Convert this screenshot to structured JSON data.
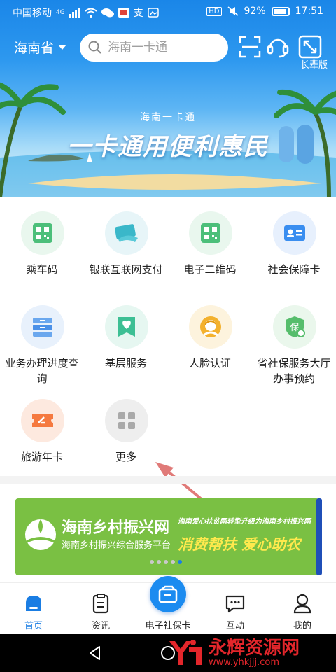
{
  "status_bar": {
    "carrier": "中国移动",
    "network": "4G",
    "hd": "HD",
    "battery": "92%",
    "time": "17:51"
  },
  "header": {
    "province": "海南省",
    "search_placeholder": "海南一卡通",
    "elder_mode_label": "长辈版",
    "icons": [
      "scan-icon",
      "customer-service-icon",
      "elder-mode-icon"
    ]
  },
  "hero_banner": {
    "subtitle": "海南一卡通",
    "title": "一卡通用便利惠民"
  },
  "services": [
    {
      "label": "乘车码",
      "icon": "qr-code-icon",
      "color": "#4cbf7a"
    },
    {
      "label": "银联互联网支付",
      "icon": "card-payment-icon",
      "color": "#3ab7c9"
    },
    {
      "label": "电子二维码",
      "icon": "qr-code-icon",
      "color": "#4cbf7a"
    },
    {
      "label": "社会保障卡",
      "icon": "id-card-icon",
      "color": "#3a8ef0"
    },
    {
      "label": "业务办理进度查询",
      "icon": "progress-query-icon",
      "color": "#4a90e8"
    },
    {
      "label": "基层服务",
      "icon": "heart-hand-icon",
      "color": "#3dbf94"
    },
    {
      "label": "人脸认证",
      "icon": "face-icon",
      "color": "#f3b12e"
    },
    {
      "label": "省社保服务大厅办事预约",
      "icon": "appointment-icon",
      "color": "#56bd6c"
    },
    {
      "label": "旅游年卡",
      "icon": "ticket-icon",
      "color": "#f5793f"
    },
    {
      "label": "更多",
      "icon": "more-grid-icon",
      "color": "#a9a9a9"
    }
  ],
  "promo": {
    "title": "海南乡村振兴网",
    "subtitle": "海南乡村振兴综合服务平台",
    "tagline_small": "海南爱心扶贫网转型升级为海南乡村振兴网",
    "tagline_big": "消费帮扶 爱心助农"
  },
  "tabbar": [
    {
      "label": "首页",
      "icon": "home-icon",
      "active": true
    },
    {
      "label": "资讯",
      "icon": "news-icon",
      "active": false
    },
    {
      "label": "电子社保卡",
      "icon": "wallet-icon",
      "active": false
    },
    {
      "label": "互动",
      "icon": "chat-icon",
      "active": false
    },
    {
      "label": "我的",
      "icon": "profile-icon",
      "active": false
    }
  ],
  "watermark": {
    "name": "永辉资源网",
    "url": "www.yhkjjj.com"
  },
  "colors": {
    "primary": "#1a7de3",
    "header_blue": "#1a86e8",
    "promo_green": "#7ac043",
    "promo_yellow": "#ffe94d",
    "watermark_red": "#e3262b",
    "arrow": "#e07a78"
  }
}
